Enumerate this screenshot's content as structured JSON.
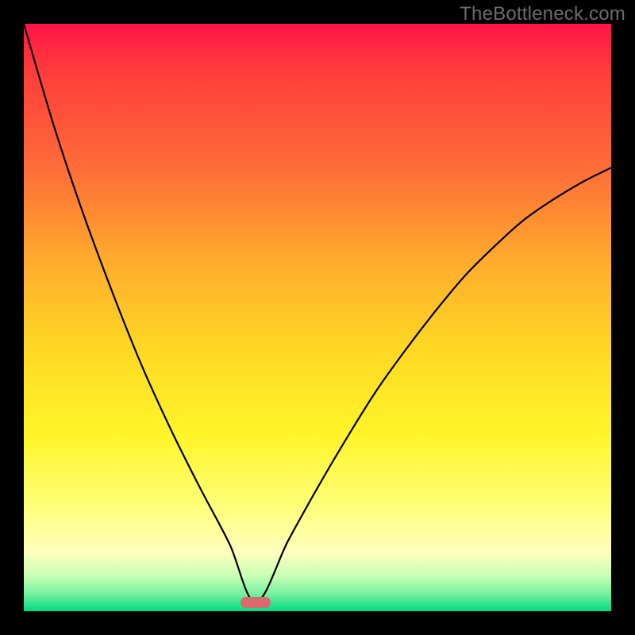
{
  "watermark": "TheBottleneck.com",
  "marker": {
    "cx_u": 0.395,
    "cy_u": 0.985
  },
  "colors": {
    "curve_stroke": "#000000",
    "marker_fill": "#d96a6e",
    "frame_bg": "#000000"
  },
  "chart_data": {
    "type": "line",
    "title": "",
    "xlabel": "",
    "ylabel": "",
    "xlim": [
      0,
      1
    ],
    "ylim": [
      0,
      1
    ],
    "note": "x,y are normalized plot-area units (0..1, origin top-left); curve is a V shape dipping to y≈1 at x≈0.40",
    "series": [
      {
        "name": "curve",
        "x": [
          0.0,
          0.05,
          0.1,
          0.15,
          0.2,
          0.25,
          0.3,
          0.35,
          0.395,
          0.45,
          0.5,
          0.55,
          0.6,
          0.65,
          0.7,
          0.75,
          0.8,
          0.85,
          0.9,
          0.95,
          1.0
        ],
        "y": [
          0.0,
          0.17,
          0.32,
          0.455,
          0.58,
          0.69,
          0.79,
          0.885,
          0.985,
          0.88,
          0.79,
          0.705,
          0.625,
          0.555,
          0.49,
          0.43,
          0.38,
          0.335,
          0.3,
          0.27,
          0.245
        ]
      }
    ]
  }
}
